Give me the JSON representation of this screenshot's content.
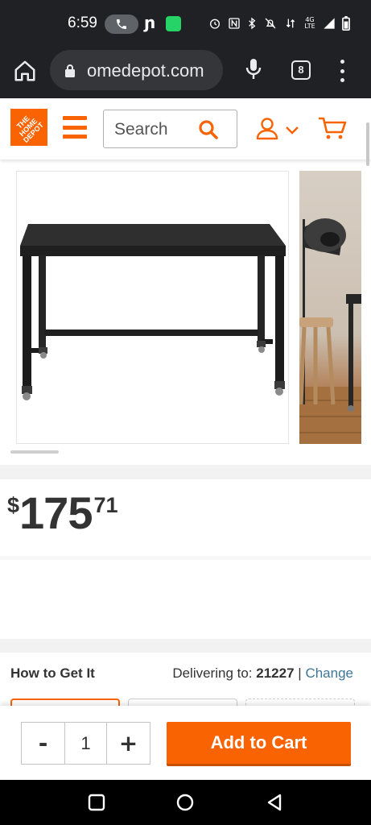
{
  "status_bar": {
    "time": "6:59",
    "network": "4G LTE"
  },
  "browser": {
    "url": "omedepot.com",
    "tab_count": "8"
  },
  "site_header": {
    "search_placeholder": "Search",
    "brand_color": "#f96302"
  },
  "product": {
    "price": {
      "symbol": "$",
      "dollars": "175",
      "cents": "71"
    },
    "gallery": {
      "images": [
        "black-metal-desk-on-casters",
        "desk-with-floor-lamp-room-scene"
      ]
    }
  },
  "fulfillment": {
    "title": "How to Get It",
    "delivering_label": "Delivering to:",
    "zip": "21227",
    "separator": "|",
    "change_label": "Change"
  },
  "cart_bar": {
    "decrement_label": "-",
    "quantity": "1",
    "increment_label": "+",
    "add_to_cart_label": "Add to Cart"
  },
  "icons": {
    "home": "home-icon",
    "lock": "lock-icon",
    "mic": "microphone-icon",
    "menu": "hamburger-menu-icon",
    "search": "search-icon",
    "account": "user-icon",
    "cart": "cart-icon",
    "nav_back": "back-triangle-icon",
    "nav_home": "circle-home-icon",
    "nav_recents": "square-recents-icon"
  }
}
